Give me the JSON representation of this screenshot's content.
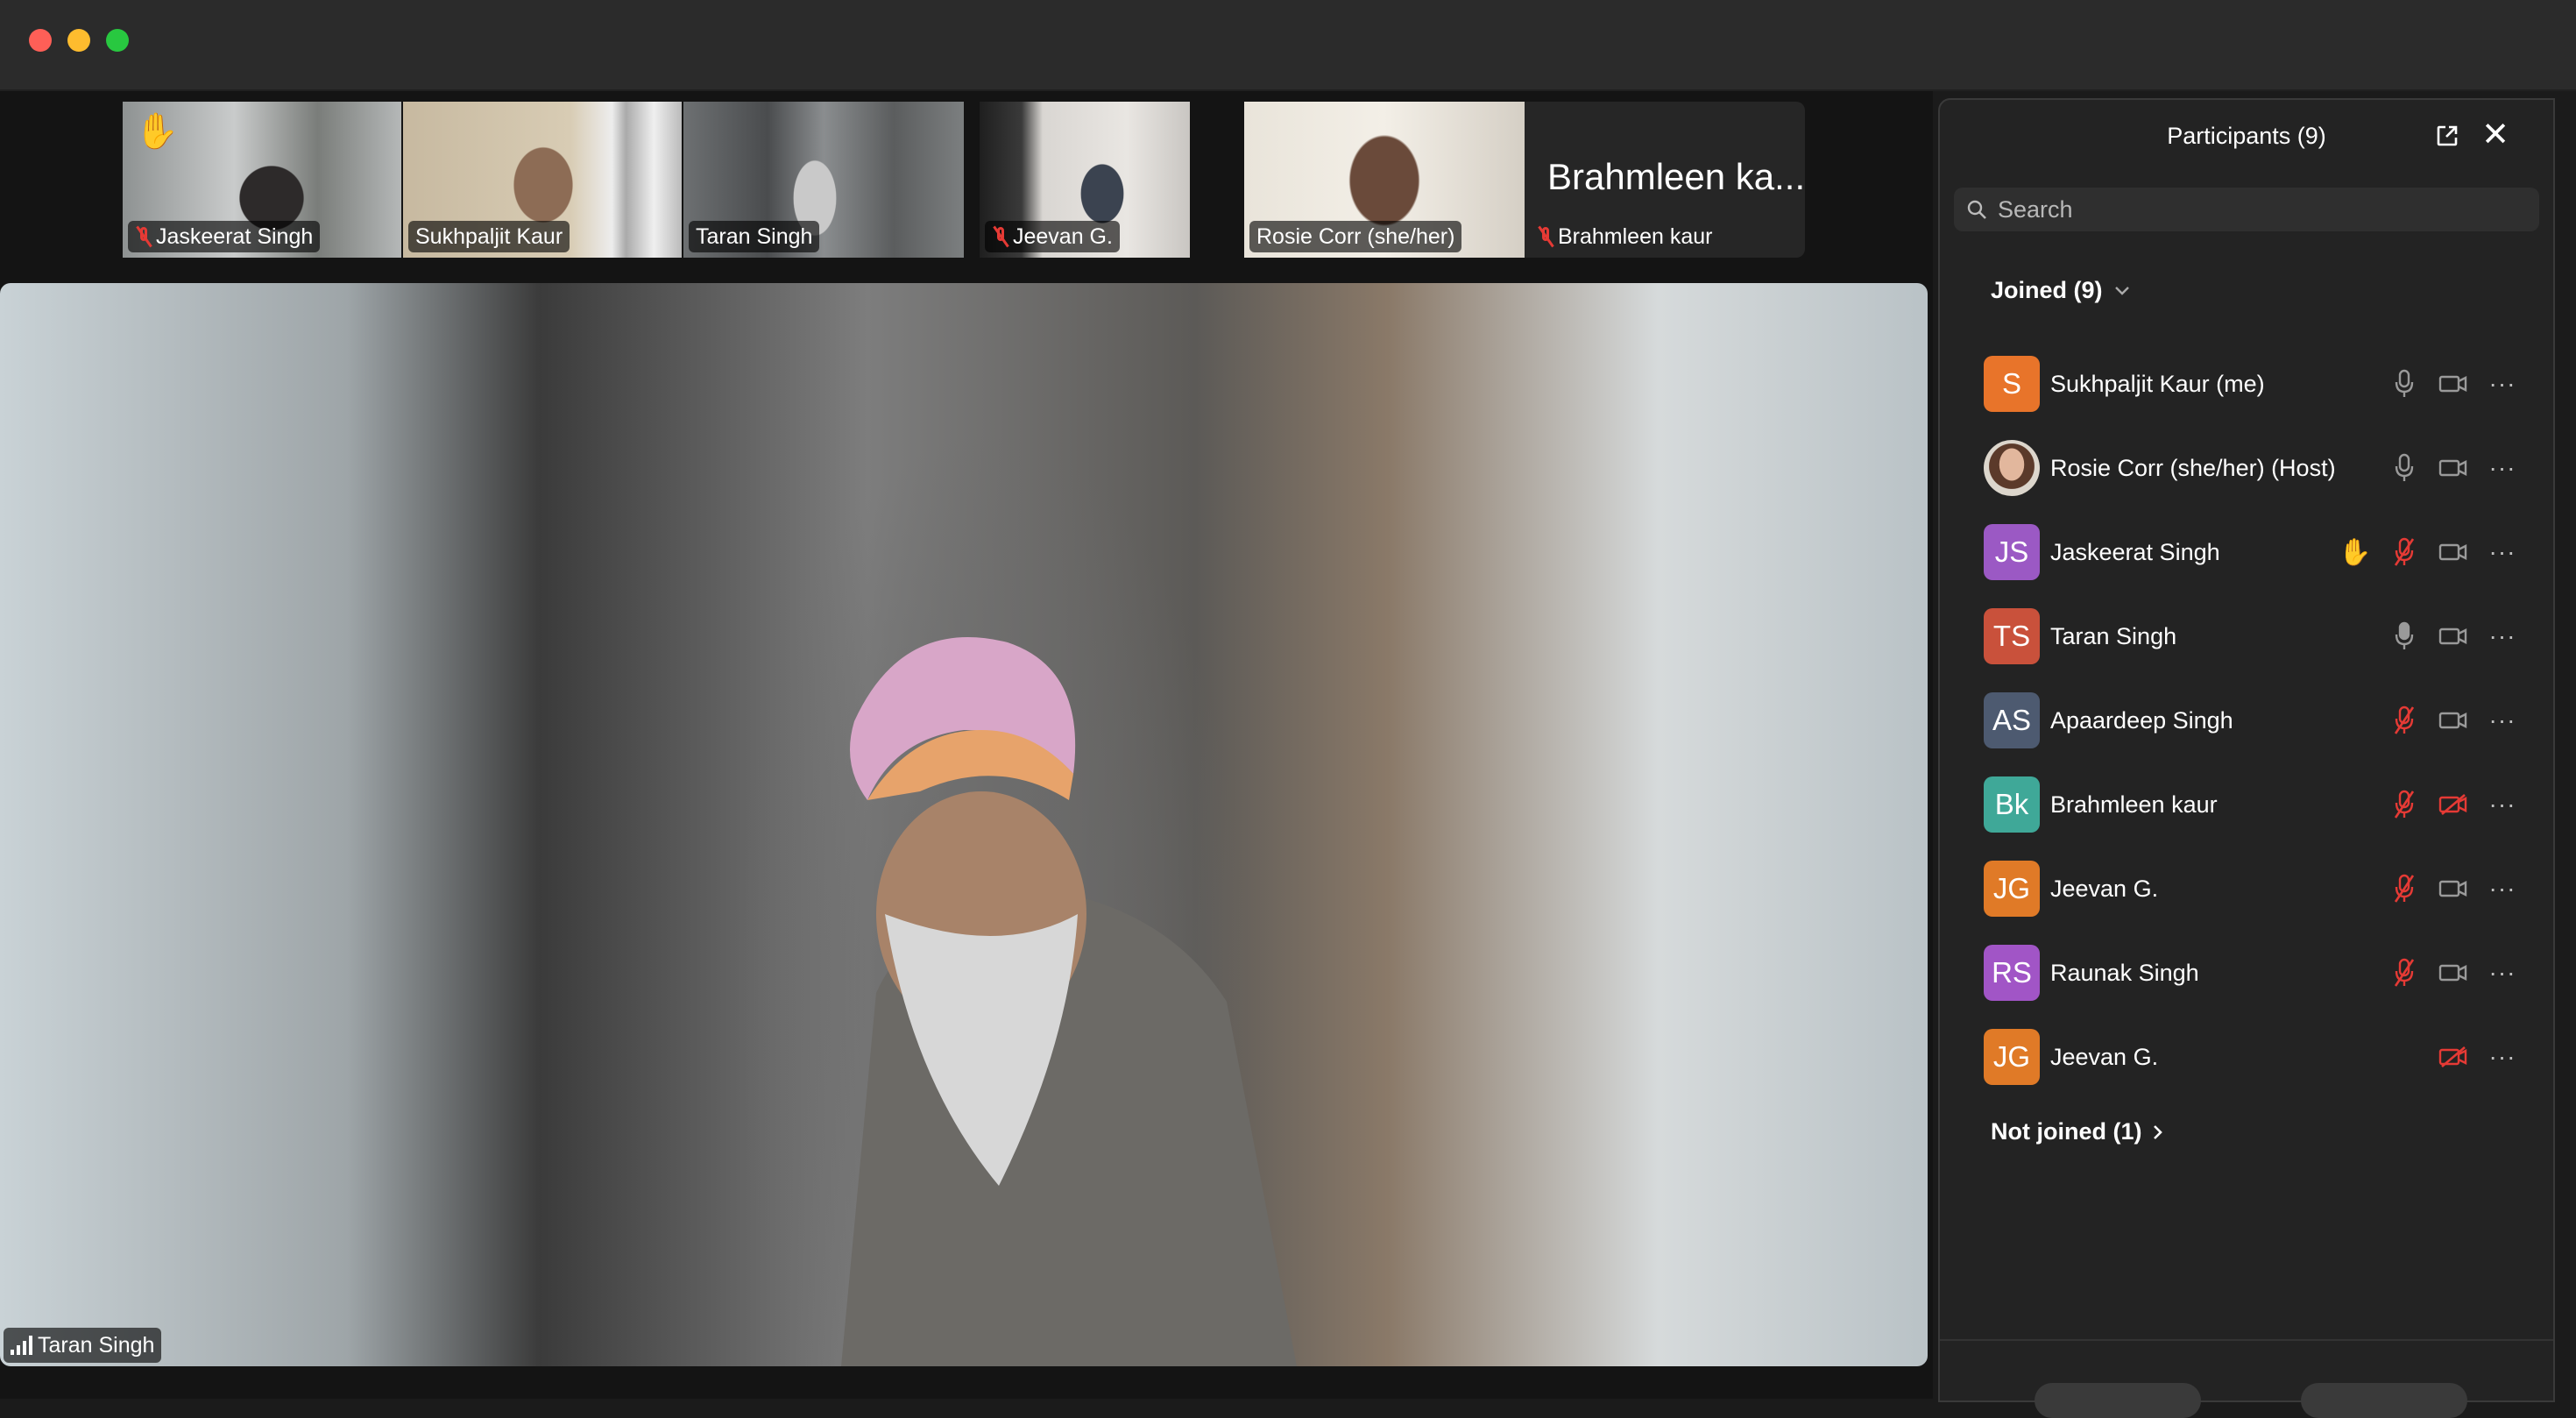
{
  "thumbnails": [
    {
      "name": "Jaskeerat Singh",
      "muted": true,
      "hand_raised": true
    },
    {
      "name": "Sukhpaljit Kaur",
      "muted": false
    },
    {
      "name": "Taran Singh",
      "muted": false,
      "active": true
    },
    {
      "name": "Jeevan G.",
      "muted": true
    },
    {
      "name": "Rosie Corr (she/her)",
      "muted": false
    },
    {
      "name": "Brahmleen kaur",
      "display": "Brahmleen ka...",
      "muted": true
    }
  ],
  "main_video": {
    "speaker": "Taran Singh"
  },
  "panel": {
    "title": "Participants (9)",
    "search_placeholder": "Search",
    "joined_label": "Joined (9)",
    "not_joined_label": "Not joined (1)",
    "participants": [
      {
        "initials": "S",
        "name": "Sukhpaljit Kaur (me)",
        "color": "#e8742a",
        "mic": "on",
        "video": "on",
        "hand": false
      },
      {
        "initials": "",
        "name": "Rosie Corr (she/her) (Host)",
        "color": "#8a6a55",
        "mic": "on",
        "video": "on",
        "hand": false,
        "photo": true
      },
      {
        "initials": "JS",
        "name": "Jaskeerat Singh",
        "color": "#9b59c4",
        "mic": "muted",
        "video": "on",
        "hand": true
      },
      {
        "initials": "TS",
        "name": "Taran Singh",
        "color": "#c9513b",
        "mic": "speaking",
        "video": "on",
        "hand": false
      },
      {
        "initials": "AS",
        "name": "Apaardeep Singh",
        "color": "#4d5a70",
        "mic": "muted",
        "video": "on",
        "hand": false
      },
      {
        "initials": "Bk",
        "name": "Brahmleen kaur",
        "color": "#3fa898",
        "mic": "muted",
        "video": "off",
        "hand": false
      },
      {
        "initials": "JG",
        "name": "Jeevan G.",
        "color": "#e07a27",
        "mic": "muted",
        "video": "on",
        "hand": false
      },
      {
        "initials": "RS",
        "name": "Raunak Singh",
        "color": "#a155c6",
        "mic": "muted",
        "video": "on",
        "hand": false
      },
      {
        "initials": "JG",
        "name": "Jeevan G.",
        "color": "#e07a27",
        "mic": "none",
        "video": "off",
        "hand": false
      }
    ]
  },
  "colors": {
    "active_speaker": "#31c54f",
    "muted_red": "#e53a35",
    "panel_bg": "#232323"
  },
  "icons": {
    "hand": "✋",
    "more": "···",
    "close": "✕",
    "chevron_down": "chevron-down-icon",
    "chevron_right": "chevron-right-icon"
  }
}
